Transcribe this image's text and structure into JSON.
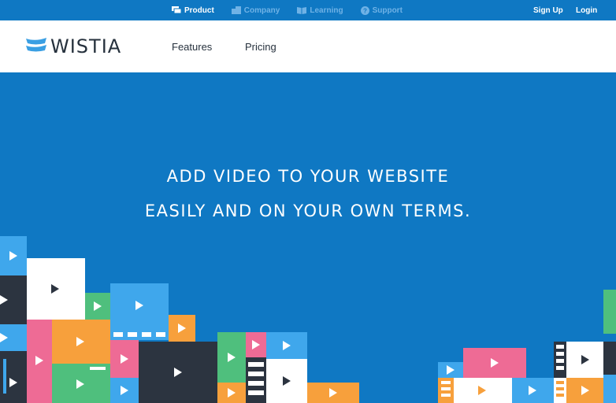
{
  "topbar": {
    "items": [
      {
        "label": "Product",
        "icon": "product-icon",
        "active": true
      },
      {
        "label": "Company",
        "icon": "company-icon",
        "active": false
      },
      {
        "label": "Learning",
        "icon": "book-icon",
        "active": false
      },
      {
        "label": "Support",
        "icon": "question-icon",
        "active": false
      }
    ],
    "signup_label": "Sign Up",
    "login_label": "Login"
  },
  "header": {
    "logo_text": "WISTIA",
    "nav": [
      {
        "label": "Features"
      },
      {
        "label": "Pricing"
      }
    ]
  },
  "hero": {
    "line1": "ADD VIDEO TO YOUR WEBSITE",
    "line2": "EASILY AND ON YOUR OWN TERMS."
  },
  "colors": {
    "brand_blue": "#0f78c3",
    "light_blue": "#3fa7ec",
    "dark": "#2c3440",
    "pink": "#ee6b95",
    "orange": "#f7a03c",
    "green": "#4fbf7d",
    "white": "#ffffff"
  }
}
